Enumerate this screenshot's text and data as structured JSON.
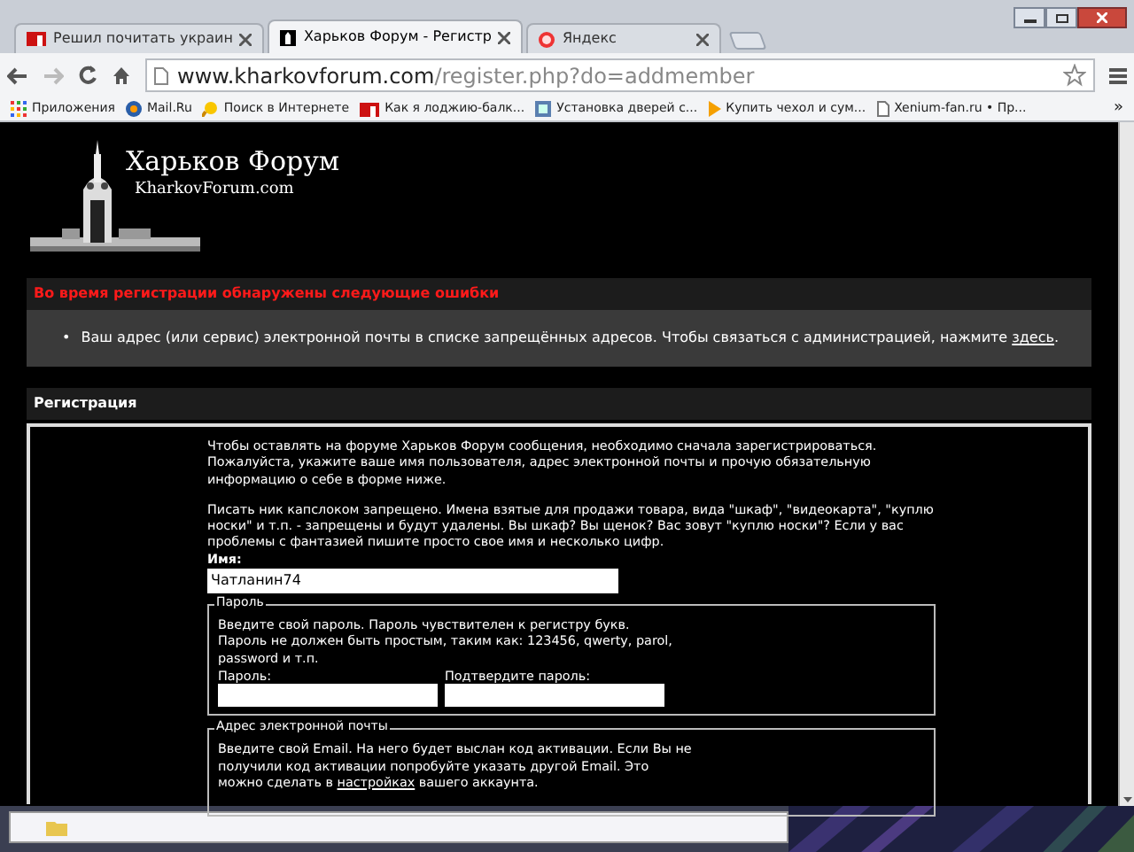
{
  "browser": {
    "tabs": [
      {
        "title": "Решил почитать украин",
        "kind": "yap",
        "selected": false
      },
      {
        "title": "Харьков Форум - Регистр",
        "kind": "forum",
        "selected": true
      },
      {
        "title": "Яндекс",
        "kind": "yandex",
        "selected": false
      }
    ],
    "address": {
      "domain": "www.kharkovforum.com",
      "path": "/register.php?do=addmember"
    },
    "bookmarks": [
      {
        "label": "Приложения",
        "kind": "apps"
      },
      {
        "label": "Mail.Ru",
        "kind": "mail"
      },
      {
        "label": "Поиск в Интернете",
        "kind": "search"
      },
      {
        "label": "Как я лоджию-балк...",
        "kind": "yap"
      },
      {
        "label": "Установка дверей с...",
        "kind": "site"
      },
      {
        "label": "Купить чехол и сум...",
        "kind": "play"
      },
      {
        "label": "Xenium-fan.ru • Пр...",
        "kind": "page"
      }
    ],
    "more": "»"
  },
  "page": {
    "logo": {
      "title": "Харьков Форум",
      "subtitle": "KharkovForum.com"
    },
    "errors": {
      "title": "Во время регистрации обнаружены следующие ошибки",
      "items": [
        {
          "marker": "•",
          "text": "Ваш адрес (или сервис) электронной почты в списке запрещённых адресов. Чтобы связаться с администрацией, нажмите ",
          "link": "здесь",
          "after": "."
        }
      ]
    },
    "section_title": "Регистрация",
    "intro": "Чтобы оставлять на форуме Харьков Форум сообщения, необходимо сначала зарегистрироваться. Пожалуйста, укажите ваше имя пользователя, адрес электронной почты и прочую обязательную информацию о себе в форме ниже.",
    "rules": "Писать ник капслоком запрещено. Имена взятые для продажи товара, вида \"шкаф\", \"видеокарта\", \"куплю носки\" и т.п. - запрещены и будут удалены. Вы шкаф? Вы щенок? Вас зовут \"куплю носки\"? Если у вас проблемы с фантазией пишите просто свое имя и несколько цифр.",
    "name": {
      "label": "Имя:",
      "value": "Чатланин74"
    },
    "password": {
      "legend": "Пароль",
      "description": "Введите свой пароль. Пароль чувствителен к регистру букв. Пароль не должен быть простым, таким как: 123456, qwerty, parol, password и т.п.",
      "fields": [
        {
          "label": "Пароль:"
        },
        {
          "label": "Подтвердите пароль:"
        }
      ]
    },
    "email": {
      "legend": "Адрес электронной почты",
      "description": "Введите свой Email. На него будет выслан код активации. Если Вы не получили код активации попробуйте указать другой Email. Это можно сделать в ",
      "link": "настройках",
      "after": " вашего аккаунта."
    }
  }
}
